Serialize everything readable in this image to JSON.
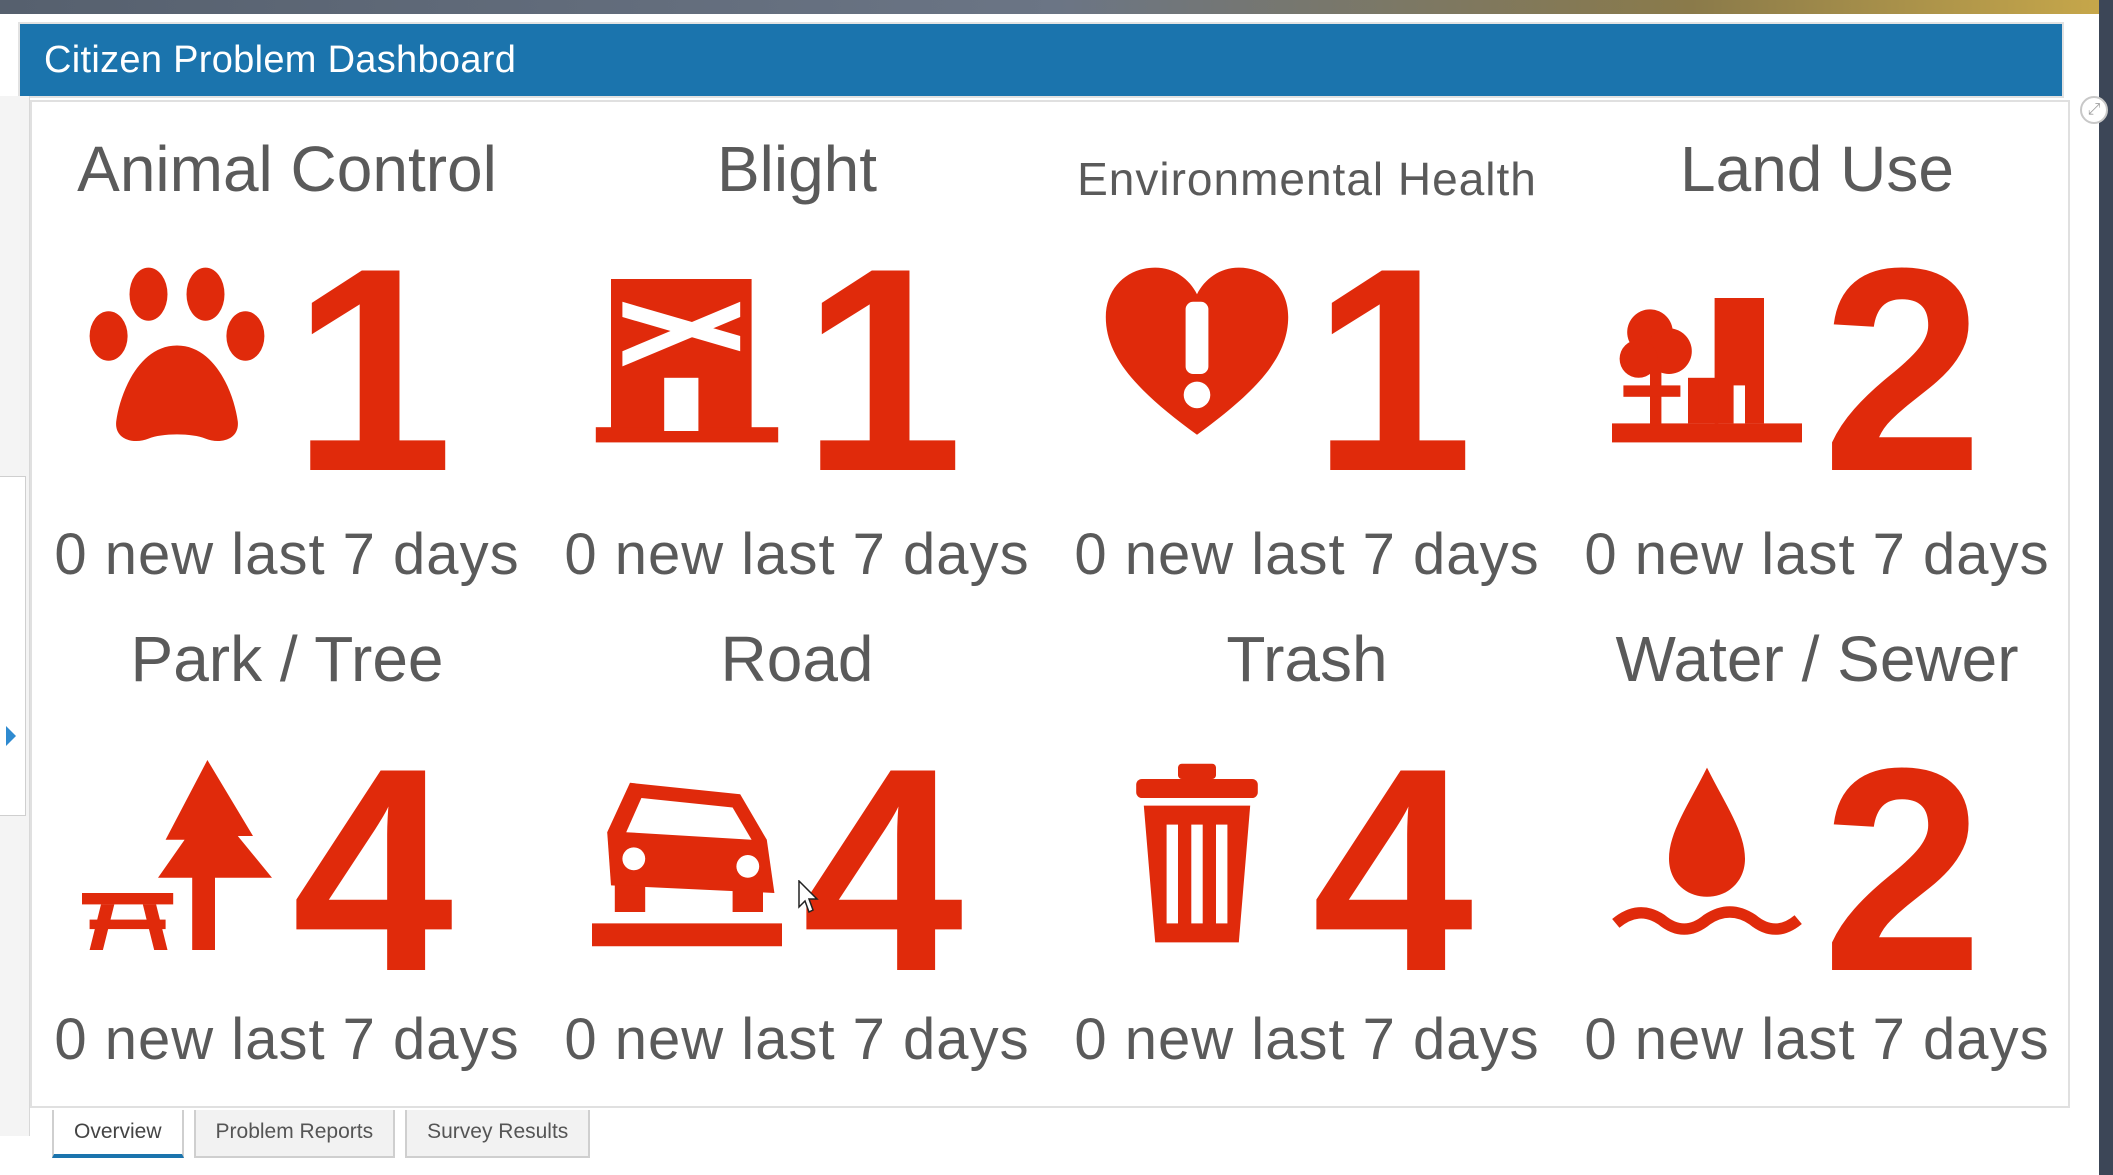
{
  "window": {
    "title": "Citizen Problem Dashboard"
  },
  "accent_color": "#e02a0b",
  "header_color": "#1b74ad",
  "tiles": [
    {
      "title": "Animal Control",
      "icon": "paw-icon",
      "count": "1",
      "sub": "0 new last 7 days"
    },
    {
      "title": "Blight",
      "icon": "blight-building-icon",
      "count": "1",
      "sub": "0 new last 7 days"
    },
    {
      "title": "Environmental Health",
      "icon": "heart-alert-icon",
      "count": "1",
      "sub": "0 new last 7 days"
    },
    {
      "title": "Land Use",
      "icon": "land-use-icon",
      "count": "2",
      "sub": "0 new last 7 days"
    },
    {
      "title": "Park / Tree",
      "icon": "picnic-tree-icon",
      "count": "4",
      "sub": "0 new last 7 days"
    },
    {
      "title": "Road",
      "icon": "car-pothole-icon",
      "count": "4",
      "sub": "0 new last 7 days"
    },
    {
      "title": "Trash",
      "icon": "trash-can-icon",
      "count": "4",
      "sub": "0 new last 7 days"
    },
    {
      "title": "Water / Sewer",
      "icon": "water-drop-icon",
      "count": "2",
      "sub": "0 new last 7 days"
    }
  ],
  "tabs": [
    {
      "label": "Overview",
      "active": true
    },
    {
      "label": "Problem Reports",
      "active": false
    },
    {
      "label": "Survey Results",
      "active": false
    }
  ]
}
